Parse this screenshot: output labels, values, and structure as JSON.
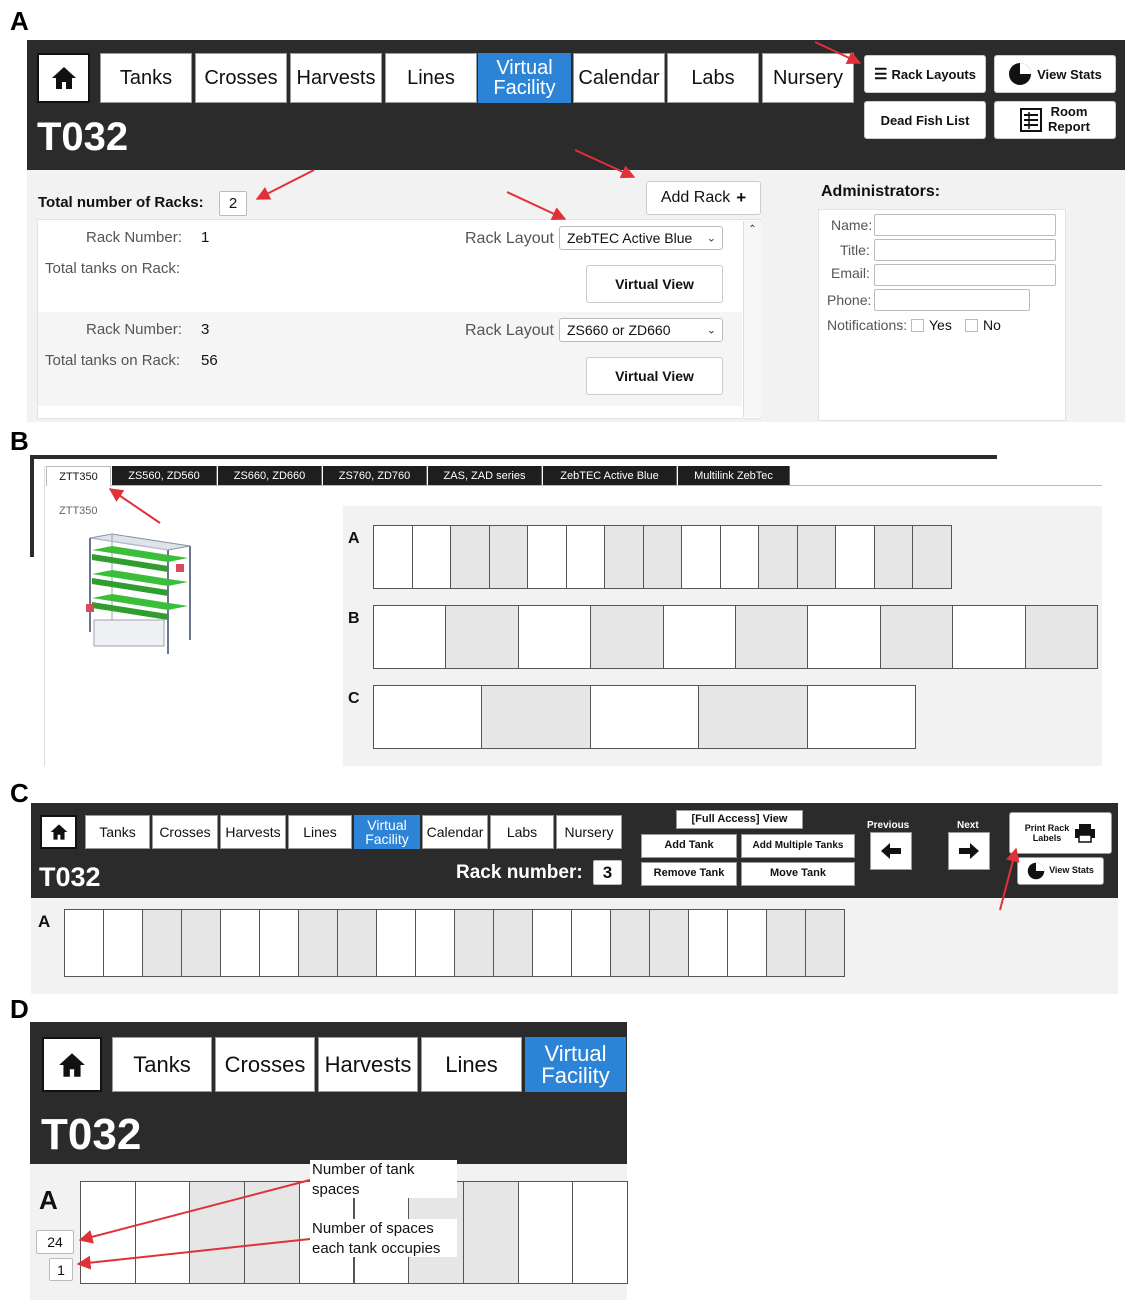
{
  "panel_letters": {
    "a": "A",
    "b": "B",
    "c": "C",
    "d": "D"
  },
  "nav": {
    "tanks": "Tanks",
    "crosses": "Crosses",
    "harvests": "Harvests",
    "lines": "Lines",
    "virtual_facility_line1": "Virtual",
    "virtual_facility_line2": "Facility",
    "calendar": "Calendar",
    "labs": "Labs",
    "nursery": "Nursery"
  },
  "room_title": "T032",
  "panel_a": {
    "rack_layouts": "Rack Layouts",
    "view_stats": "View Stats",
    "dead_fish_list": "Dead Fish List",
    "room_report_line1": "Room",
    "room_report_line2": "Report",
    "total_racks_label": "Total number of Racks:",
    "total_racks_value": "2",
    "add_rack": "Add Rack",
    "racks": [
      {
        "rack_number_label": "Rack Number:",
        "rack_number": "1",
        "layout_label": "Rack Layout",
        "layout_value": "ZebTEC Active Blue",
        "tanks_label": "Total tanks on Rack:",
        "tanks_value": "",
        "virtual_view": "Virtual View"
      },
      {
        "rack_number_label": "Rack Number:",
        "rack_number": "3",
        "layout_label": "Rack Layout",
        "layout_value": "ZS660 or ZD660",
        "tanks_label": "Total tanks on Rack:",
        "tanks_value": "56",
        "virtual_view": "Virtual View"
      }
    ],
    "administrators": {
      "heading": "Administrators:",
      "name_label": "Name:",
      "title_label": "Title:",
      "email_label": "Email:",
      "phone_label": "Phone:",
      "notifications_label": "Notifications:",
      "yes": "Yes",
      "no": "No"
    }
  },
  "panel_b": {
    "tabs": [
      "ZTT350",
      "ZS560, ZD560",
      "ZS660, ZD660",
      "ZS760, ZD760",
      "ZAS, ZAD series",
      "ZebTEC Active Blue",
      "Multilink ZebTec"
    ],
    "active_tab_caption": "ZTT350",
    "rows": [
      {
        "label": "A",
        "pattern": [
          "w",
          "w",
          "g",
          "g",
          "w",
          "w",
          "g",
          "g",
          "w",
          "w",
          "g",
          "g",
          "w",
          "g",
          "g"
        ]
      },
      {
        "label": "B",
        "pattern": [
          "w",
          "g",
          "w",
          "g",
          "w",
          "g",
          "w",
          "g",
          "w",
          "g"
        ]
      },
      {
        "label": "C",
        "pattern": [
          "w",
          "g",
          "w",
          "g",
          "w"
        ]
      }
    ]
  },
  "panel_c": {
    "full_access": "[Full Access] View",
    "add_tank": "Add Tank",
    "add_multiple_tanks": "Add Multiple Tanks",
    "remove_tank": "Remove Tank",
    "move_tank": "Move Tank",
    "previous": "Previous",
    "next": "Next",
    "print_rack_labels_line1": "Print Rack",
    "print_rack_labels_line2": "Labels",
    "view_stats": "View Stats",
    "rack_number_label": "Rack number:",
    "rack_number_value": "3",
    "row_label": "A",
    "pattern": [
      "w",
      "w",
      "g",
      "g",
      "w",
      "w",
      "g",
      "g",
      "w",
      "w",
      "g",
      "g",
      "w",
      "w",
      "g",
      "g",
      "w",
      "w",
      "g",
      "g"
    ]
  },
  "panel_d": {
    "row_label": "A",
    "tank_spaces": "24",
    "spaces_per_tank": "1",
    "note1_line1": "Number of tank",
    "note1_line2": "spaces",
    "note2_line1": "Number of spaces",
    "note2_line2": "each tank occupies",
    "pattern": [
      "w",
      "w",
      "g",
      "g",
      "w",
      "w",
      "g",
      "g",
      "w",
      "w"
    ]
  },
  "colors": {
    "dark_bar": "#2b2b2b",
    "accent_blue": "#2d84d6",
    "annotation_red": "#e0303a",
    "tank_grey": "#e6e6e6"
  }
}
